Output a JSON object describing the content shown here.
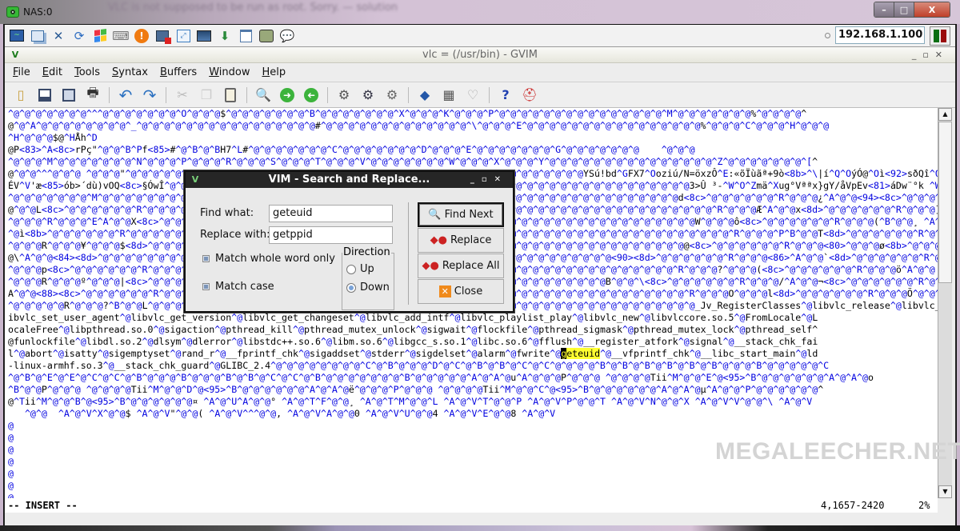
{
  "desktop": {
    "blurred_text": "VLC is not supposed to be run as root. Sorry. — solution",
    "window_title": "NAS:0",
    "window_controls": {
      "minimize": "–",
      "maximize": "□",
      "close": "X"
    }
  },
  "vnc": {
    "toolbar_icons": [
      "monitor-activity-icon",
      "windows-icon",
      "tools-icon",
      "refresh-icon",
      "windows-logo-icon",
      "keyboard-icon",
      "alert-icon",
      "disconnect-icon",
      "fullscreen-icon",
      "monitor-icon",
      "transfer-icon",
      "new-window-icon",
      "scale-icon",
      "chat-icon"
    ],
    "host": "192.168.1.100",
    "status_colors": [
      "#0a6e12",
      "#9a0c0c"
    ]
  },
  "gvim": {
    "title": "vlc = (/usr/bin) - GVIM",
    "menu": [
      {
        "label": "File",
        "mnemonic": "F",
        "rest": "ile"
      },
      {
        "label": "Edit",
        "mnemonic": "E",
        "rest": "dit"
      },
      {
        "label": "Tools",
        "mnemonic": "T",
        "rest": "ools"
      },
      {
        "label": "Syntax",
        "mnemonic": "S",
        "rest": "yntax"
      },
      {
        "label": "Buffers",
        "mnemonic": "B",
        "rest": "uffers"
      },
      {
        "label": "Window",
        "mnemonic": "W",
        "rest": "indow"
      },
      {
        "label": "Help",
        "mnemonic": "H",
        "rest": "elp"
      }
    ],
    "toolbar": [
      "open",
      "save",
      "save-all",
      "print",
      "|",
      "undo",
      "redo",
      "|",
      "cut",
      "copy",
      "paste",
      "|",
      "find-replace",
      "find-next",
      "find-prev",
      "|",
      "load-session",
      "save-session",
      "run-script",
      "|",
      "make",
      "ctags",
      "jump-tag",
      "|",
      "help",
      "find-help"
    ],
    "editor_lines": [
      "^@^@^@^@^@^@^@^^^@^@^@^@^@^@^@^O^@^@^@$^@^@^@^@^@^@^@^B^@^@^@^@^@^@^@^X^@^@^@^K^@^@^@^P^@^@^@^@^@^@^@^@^@^@^@^@^@^@^@^M^@^@^@^@^@^@^@%^@^@^@^@^",
      "@^@^A^@^@^@^@^@^@^@^@^_^@^@^@^@^@^@^@^@^@^@^@^@^@^@^@^@#^@^@^@^@^@^@^@^@^@^@^@^@^@^\\^@^@^@^E^@^@^@^@^@^@^@^@^@^@^@^@^@^@^@^@%^@^@^@^C^@^@^@^H^@^@^@",
      "^H^@^@^@$@^HÅh^D",
      "@P<83>^A<8c>rPç\"^@^@^B^Pf<85>#^@^B^@^BH7^L#^@^@^@^@^@^@^@^C^@^@^@^@^@^@^@^D^@^@^@^E^@^@^@^@^@^@^@^G^@^@^@^@^@^@^@    ^@^@^@",
      "^@^@^@^M^@^@^@^@^@^@^@^N^@^@^@^P^@^@^@^R^@^@^@^S^@^@^@^T^@^@^@^V^@^@^@^@^@^@^@^W^@^@^@^X^@^@^@^Y^@^@^@^@^@^@^@^@^@^@^@^@^@^@^@^Z^@^@^@^@^@^@^@^[^",
      "@^@^@^^^@^@^@ ^@^@^@\"^@^@^@^@^@^@^@^@^@^@^@^@^@^@^@^@^@^@^@^@^@^@^@^@^@^@^@^@^@^@^@^@^@^@^@^@^@^@^@^@^@YSú!bd^GFX7^Ooziú/N=öxzÔ^E:«õÏùãª+9ò<8b>^\\|í^Q^OýÓ@^Oì<92>sðQî^Qãi",
      "ÉV^V'æ<85>ób>´dù)vOQ<8c>§ÓwÎ^@^@^@^@^@^@^@^@^@^@^@^@^@^@^@^@^@^@^@^@^@^@^@^@^@^@^@^@^@^@^@^@^@^@^@^@^@^@^@^@^@^@^@^@^@^@^@3>Û ³-^W^O^Zmä^Xug°Vªªx}gY/åVpEv<81>áDw¨°k ^Wêvþ^@^@^@^@^@^@^@^@",
      "^@^@^@^@^@^@^@^M^@^@^@^@^@^@^@^@^@^@^@^@^@^@^@^@^@^@^@^@^@^@^@^@^@^@^@^@^@^@^@^@^@^@^@^@^@^@^@^@^@^@^@^@^@^@^@^@^@^@^@^@d<8c>^@^@^@^@^@^@^R^@^@^@¿^A^@^@<94><8c>^@^@^@^@^@^R^@^@^@m^",
      "@^@^@L<8c>^@^@^@^@^@^@^R^@^@^@^@^@^@^@^@^@^@^@^@^@^@^@^@^@^@^@^@^@^@^@^@^@^@^@^@^@^@^@^@^@^@^@^@^@^@^@^@^@^@^@^@^@^@^@^@^@^@^@^R^@^@^@Æ^A^@^@x<8d>^@^@^@^@^@^@^R^@^@^@]^B^@^@^D<8c>^@^@^@",
      "^@^@^@^R^@^@^@^E^A^@^@X<8c>^@^@^@^@^@^@^@^@^@^@^@^@^@^@^@^@^@^@^@^@^@^@^@^@^@^@^@^@^@^@^@^@^@^@^@^@^@^@^@^@^@^@^@^@^@^@^@^@W^@^@^@ô<8c>^@^@^@^@^@^@^R^@^@^@(^B^@^@¸ ^A^@^D^@^@^@^Q^@^Y^@ð^A^@",
      "^@ì<8b>^@^@^@^@^@^@^R^@^@^@^@^@^@^@^@^@^@^@^@^@^@^@^@^@^@^@^@^@^@^@^@^@^@^@^@^@^@^@^@^@^@^@^@^@^@^@^@^@^@^@^@^@^@^@^@^@^@^@^@^@^@^R^@^@^@^P^B^@^@T<8d>^@^@^@^@^@^@^R^@^@^@/^B^@^@H<8d>^@^@^@^@",
      "^@^@^@R^@^@^@¥^@^@^@$<8d>^@^@^@^@^@^@^@^@^@^@^@^@^@^@^@^@^@^@^@^@^@^@^@^@^@^@^@^@^@^@^@^@^@^@^@^@^@^@^@^@^@^@^@^@^@^@^@^@@<8c>^@^@^@^@^@^@^R^@^@^@<80>^@^@^@ø<8b>^@^@^@^@^@^@^R^@^@^",
      "@\\^A^@^@<84><8d>^@^@^@^@^@^@^@^@^@^@^@^@^@^@^@^@^@^@^@^@^@^@^@^@^@^@^@^@^@^@^@^@^@^@^@^@^@^@^@^@^@^@^@^@^@^@<90><8d>^@^@^@^@^@^@^R^@^@^@<86>^A^@^@`<8d>^@^@^@^@^@^@^R^@^@^@i^A",
      "^@^@^@p<8c>^@^@^@^@^@^@^R^@^@^@^@^@^@^@^@^@^@^@^@^@^@^@^@^@^@^@^@^@^@^@^@^@^@^@^@^@^@^@^@^@^@^@^@^@^@^@^@^@^@^@^@^@^@^@^R^@^@^@?^@^@^@(<8c>^@^@^@^@^@^@^R^@^@^@ö^A^@^@ <8c>^@^@^@^@",
      "^@^@^@R^@^@^@º^@^@^@|<8c>^@^@^@^@^@^@^@^@^@^@^@^@^@^@^@^@^@^@^@^@^@^@^@^@^@^@^@^@^@^@^@^@^@^@^@^@^@^@^@^@^@B^@^@^\\<8c>^@^@^@^@^@^@^R^@^@^@/^A^@^@¬<8c>^@^@^@^@^@^@^R^@^@^@^R^",
      "A^@^@<88><8c>^@^@^@^@^@^@^R^@^@^@^@^@^@^@^@^@^@^@^@^@^@^@^@^@^@^@^@^@^@^@^@^@^@^@^@^@^@^@^@^@^@^@^@^@^@^@^@^@^@^@^@^@^@^@^R^@^@^@O^@^@^@l<8d>^@^@^@^@^@^@^R^@^@^@Õ^@^@^@Ä<8c>^@",
      "^@^@^@^@^@R^@^@^@?^B^@^@L^@^@^@^@^@^@^@^@^@^@^@^@^@^@^@^@^@^@^@^@^@^@^@^@^@^@^@^@^@^@^@^@^@^@^@^@^@^@^@^@^@^@^@^@^@^@^@^@^@_Jv_RegisterClasses^@libvlc_release^@libvlc_set_exit_handler^@l",
      "ibvlc_set_user_agent^@libvlc_get_version^@libvlc_get_changeset^@libvlc_add_intf^@libvlc_playlist_play^@libvlc_new^@libvlccore.so.5^@FromLocale^@L",
      "ocaleFree^@libpthread.so.0^@sigaction^@pthread_kill^@pthread_mutex_unlock^@sigwait^@flockfile^@pthread_sigmask^@pthread_mutex_lock^@pthread_self^",
      "@funlockfile^@libdl.so.2^@dlsym^@dlerror^@libstdc++.so.6^@libm.so.6^@libgcc_s.so.1^@libc.so.6^@fflush^@__register_atfork^@signal^@__stack_chk_fai",
      "l^@abort^@isatty^@sigemptyset^@rand_r^@__fprintf_chk^@sigaddset^@stderr^@sigdelset^@alarm^@fwrite^@",
      "-linux-armhf.so.3^@__stack_chk_guard^@GLIBC_2.4^@^@^@^@^@^@^@^@^C^@^B^@^@^@^D^@^C^@^B^@^B^@^C^@^C^@^@^@^@^B^@^B^@^B^@^B^@^B^@^B^@^@^@^B^@^@^@^@^@^C",
      "^@^B^@^E^@^E^@^C^@^C^@^B^@^@^@^B^@^@^@^B^@^B^@^C^@^C^@^B^@^@^@^@^@^@^@^B^@^@^@^@^@^A^@^A^@u^A^@^@^@P^@^@^@ ^@^@^@^@Tii^M^@^@^E^@<95>^B^@^@^@^@^@^@^A^@^A^@o",
      "^B^@^@P^@^@^@ ^@^@^@^@Tii^M^@^@^D^@<95>^B^@^@^@^@^@^@^A^@^A^@ë^@^@^@^P^@^@^@ ^@^@^@^@Tii^M^@^@^C^@<95>^B^@^@^@^@^@^@^A^@^A^@µ^A^@^@^P^@^@^@^@^@^@^",
      "@^Tii^M^@^@^B^@<95>^B^@^@^@^@^@^@¤ ^A^@^U^A^@^@° ^A^@^T^F^@^@¸ ^A^@^T^M^@^@^L ^A^@^V^T^@^@^P ^A^@^V^P^@^@^T ^A^@^V^N^@^@^X ^A^@^V^V^@^@^\\ ^A^@^V",
      "   ^@^@  ^A^@^V^X^@^@$ ^A^@^V\"^@^@( ^A^@^V^^^@^@, ^A^@^V^A^@^@0 ^A^@^V^U^@^@4 ^A^@^V^E^@^@8 ^A^@^V"
    ],
    "search_line_match": "geteuid",
    "search_line_tail": "^@__vfprintf_chk^@__libc_start_main^@ld",
    "tilde_lines": [
      "@",
      "@",
      "@",
      "@",
      "@",
      "@",
      "@"
    ],
    "mode": "-- INSERT --",
    "position": "4,1657-2420",
    "percent": "2%",
    "scroll_fraction": 0.02
  },
  "dialog": {
    "title": "VIM - Search and Replace...",
    "find_label": "Find what:",
    "find_value": "geteuid",
    "replace_label": "Replace with:",
    "replace_value": "getppid",
    "whole_word_label": "Match whole word only",
    "whole_word_checked": true,
    "match_case_label": "Match case",
    "match_case_checked": true,
    "direction_label": "Direction",
    "direction_options": [
      "Up",
      "Down"
    ],
    "direction_selected": "Down",
    "buttons": {
      "find_next": "Find Next",
      "replace": "Replace",
      "replace_all": "Replace All",
      "close": "Close"
    }
  },
  "watermark": "MEGALEECHER.NET"
}
